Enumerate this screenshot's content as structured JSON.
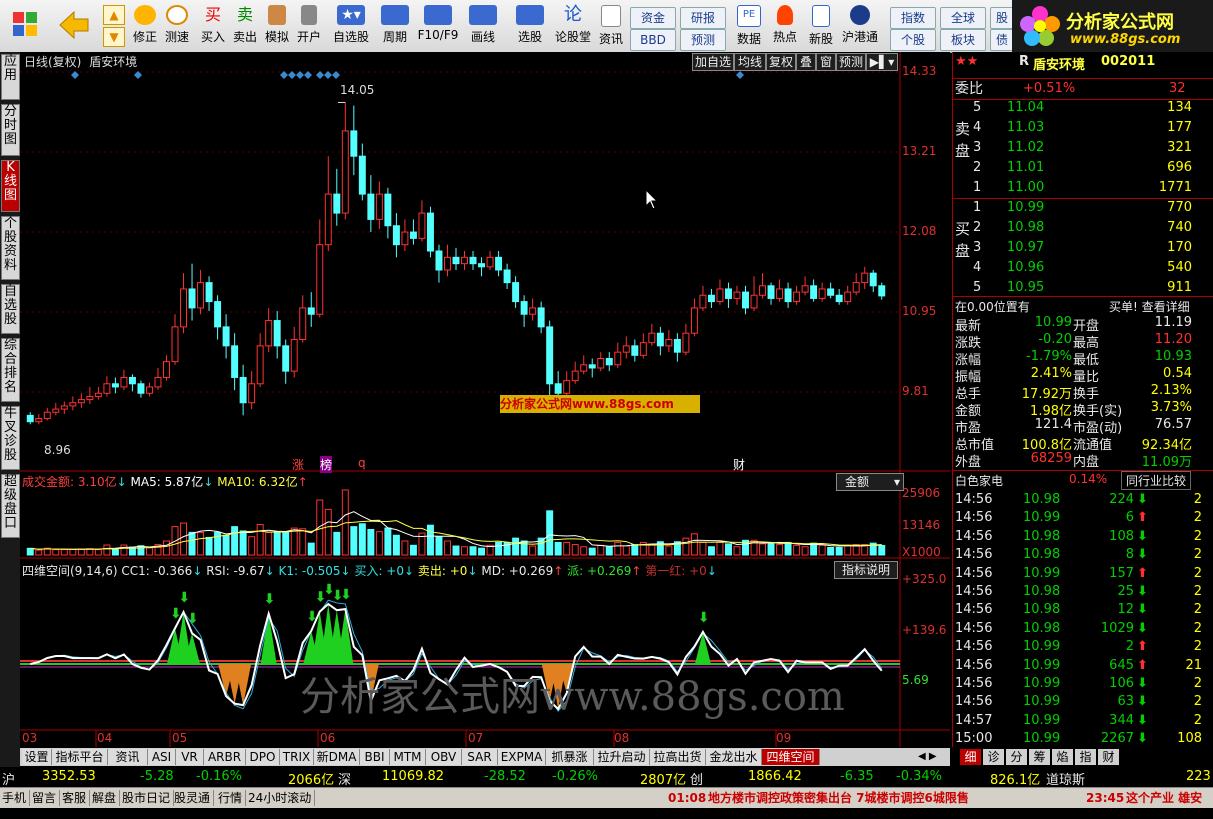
{
  "toolbar": {
    "buttons": [
      {
        "label": "修正"
      },
      {
        "label": "测速"
      },
      {
        "label": "买入"
      },
      {
        "label": "卖出"
      },
      {
        "label": "模拟"
      },
      {
        "label": "开户"
      },
      {
        "label": "自选股"
      },
      {
        "label": "周期"
      },
      {
        "label": "F10/F9"
      },
      {
        "label": "画线"
      },
      {
        "label": "选股"
      },
      {
        "label": "论股堂"
      },
      {
        "label": "资讯"
      },
      {
        "label": "数据"
      },
      {
        "label": "热点"
      },
      {
        "label": "新股"
      },
      {
        "label": "沪港通"
      }
    ],
    "small_buttons": [
      "资金",
      "研报",
      "BBD",
      "预测",
      "指数",
      "全球",
      "股",
      "个股",
      "板块",
      "债"
    ],
    "logo_text": "分析家公式网",
    "logo_url": "www.88gs.com"
  },
  "left_tabs": [
    "应用",
    "分时图",
    "K线图",
    "个股资料",
    "自选股",
    "综合排名",
    "牛叉诊股",
    "超级盘口"
  ],
  "chart": {
    "title": "日线(复权)",
    "stock_name": "盾安环境",
    "buttons": [
      "加自选",
      "均线",
      "复权",
      "叠",
      "窗",
      "预测"
    ],
    "price_labels": [
      "14.33",
      "13.21",
      "12.08",
      "10.95",
      "9.81"
    ],
    "high_label": "14.05",
    "low_label": "8.96",
    "event_labels": [
      "涨",
      "榜",
      "q",
      "财"
    ],
    "watermark_small": "分析家公式网www.88gs.com",
    "volume_header": {
      "label": "成交金额:",
      "value": "3.10亿",
      "ma5_label": "MA5:",
      "ma5": "5.87亿",
      "ma10_label": "MA10:",
      "ma10": "6.32亿"
    },
    "volume_select": "金额",
    "volume_labels": [
      "25906",
      "13146",
      "X1000"
    ],
    "indicator_header": {
      "name": "四维空间(9,14,6)",
      "cc1": "CC1: -0.366",
      "rsi": "RSI: -9.67",
      "k1": "K1: -0.505",
      "buy": "买入: +0",
      "sell": "卖出: +0",
      "md": "MD: +0.269",
      "pai": "派: +0.269",
      "red": "第一红: +0"
    },
    "indicator_button": "指标说明",
    "indicator_labels": [
      "+325.0",
      "+139.6",
      "5.69"
    ],
    "watermark_big": "分析家公式网www.88gs.com",
    "x_labels": [
      "03",
      "04",
      "05",
      "06",
      "07",
      "08",
      "09"
    ]
  },
  "chart_data": {
    "type": "candlestick",
    "title": "日线(复权) 盾安环境",
    "ylim": [
      8.6,
      14.5
    ],
    "x_axis_months": [
      "03",
      "04",
      "05",
      "06",
      "07",
      "08",
      "09"
    ],
    "candles": [
      [
        9.1,
        9.0,
        9.15,
        8.96
      ],
      [
        9.0,
        9.05,
        9.12,
        8.96
      ],
      [
        9.05,
        9.15,
        9.22,
        9.02
      ],
      [
        9.15,
        9.2,
        9.3,
        9.1
      ],
      [
        9.2,
        9.25,
        9.32,
        9.12
      ],
      [
        9.25,
        9.3,
        9.4,
        9.18
      ],
      [
        9.3,
        9.35,
        9.45,
        9.22
      ],
      [
        9.35,
        9.4,
        9.55,
        9.28
      ],
      [
        9.4,
        9.45,
        9.55,
        9.35
      ],
      [
        9.45,
        9.6,
        9.72,
        9.4
      ],
      [
        9.6,
        9.55,
        9.7,
        9.45
      ],
      [
        9.55,
        9.7,
        9.82,
        9.5
      ],
      [
        9.7,
        9.6,
        9.75,
        9.48
      ],
      [
        9.6,
        9.45,
        9.65,
        9.38
      ],
      [
        9.45,
        9.55,
        9.62,
        9.4
      ],
      [
        9.55,
        9.7,
        9.85,
        9.5
      ],
      [
        9.7,
        9.95,
        10.05,
        9.65
      ],
      [
        9.95,
        10.5,
        10.7,
        9.9
      ],
      [
        10.5,
        11.1,
        11.35,
        10.4
      ],
      [
        11.1,
        10.8,
        11.5,
        10.6
      ],
      [
        10.8,
        11.2,
        11.4,
        10.7
      ],
      [
        11.2,
        10.9,
        11.3,
        10.75
      ],
      [
        10.9,
        10.5,
        11.0,
        10.3
      ],
      [
        10.5,
        10.2,
        10.7,
        10.0
      ],
      [
        10.2,
        9.7,
        10.4,
        9.5
      ],
      [
        9.7,
        9.3,
        9.9,
        9.1
      ],
      [
        9.3,
        9.6,
        9.8,
        9.2
      ],
      [
        9.6,
        10.2,
        10.4,
        9.55
      ],
      [
        10.2,
        10.6,
        10.8,
        10.1
      ],
      [
        10.6,
        10.2,
        10.75,
        10.0
      ],
      [
        10.2,
        9.8,
        10.3,
        9.6
      ],
      [
        9.8,
        10.3,
        10.5,
        9.7
      ],
      [
        10.3,
        10.8,
        11.0,
        10.25
      ],
      [
        10.8,
        10.7,
        11.05,
        10.5
      ],
      [
        10.7,
        11.8,
        12.2,
        10.65
      ],
      [
        11.8,
        12.6,
        13.2,
        11.7
      ],
      [
        12.6,
        12.3,
        13.0,
        12.1
      ],
      [
        12.3,
        13.6,
        14.05,
        12.2
      ],
      [
        13.6,
        13.2,
        14.0,
        12.9
      ],
      [
        13.2,
        12.6,
        13.4,
        12.5
      ],
      [
        12.6,
        12.2,
        12.9,
        12.0
      ],
      [
        12.2,
        12.6,
        12.8,
        12.05
      ],
      [
        12.6,
        12.1,
        12.7,
        11.9
      ],
      [
        12.1,
        11.8,
        12.3,
        11.6
      ],
      [
        11.8,
        12.0,
        12.2,
        11.7
      ],
      [
        12.0,
        11.9,
        12.2,
        11.8
      ],
      [
        11.9,
        12.3,
        12.5,
        11.85
      ],
      [
        12.3,
        11.7,
        12.4,
        11.6
      ],
      [
        11.7,
        11.4,
        11.8,
        11.2
      ],
      [
        11.4,
        11.6,
        11.8,
        11.3
      ],
      [
        11.6,
        11.5,
        11.75,
        11.4
      ],
      [
        11.5,
        11.6,
        11.7,
        11.4
      ],
      [
        11.6,
        11.5,
        11.7,
        11.4
      ],
      [
        11.5,
        11.45,
        11.6,
        11.3
      ],
      [
        11.45,
        11.6,
        11.7,
        11.4
      ],
      [
        11.6,
        11.4,
        11.7,
        11.3
      ],
      [
        11.4,
        11.2,
        11.5,
        11.1
      ],
      [
        11.2,
        10.9,
        11.3,
        10.8
      ],
      [
        10.9,
        10.7,
        11.0,
        10.5
      ],
      [
        10.7,
        10.8,
        10.95,
        10.6
      ],
      [
        10.8,
        10.5,
        10.9,
        10.4
      ],
      [
        10.5,
        9.6,
        10.6,
        9.4
      ],
      [
        9.6,
        9.45,
        9.8,
        9.3
      ],
      [
        9.45,
        9.65,
        9.8,
        9.4
      ],
      [
        9.65,
        9.8,
        9.95,
        9.6
      ],
      [
        9.8,
        9.9,
        10.05,
        9.75
      ],
      [
        9.9,
        9.85,
        10.0,
        9.7
      ],
      [
        9.85,
        10.0,
        10.1,
        9.8
      ],
      [
        10.0,
        9.9,
        10.1,
        9.8
      ],
      [
        9.9,
        10.1,
        10.25,
        9.85
      ],
      [
        10.1,
        10.2,
        10.35,
        10.0
      ],
      [
        10.2,
        10.05,
        10.3,
        9.95
      ],
      [
        10.05,
        10.25,
        10.4,
        10.0
      ],
      [
        10.25,
        10.4,
        10.55,
        10.2
      ],
      [
        10.4,
        10.2,
        10.5,
        10.05
      ],
      [
        10.2,
        10.3,
        10.45,
        10.1
      ],
      [
        10.3,
        10.1,
        10.4,
        9.95
      ],
      [
        10.1,
        10.4,
        10.55,
        10.05
      ],
      [
        10.4,
        10.8,
        10.95,
        10.35
      ],
      [
        10.8,
        11.0,
        11.15,
        10.75
      ],
      [
        11.0,
        10.9,
        11.1,
        10.8
      ],
      [
        10.9,
        11.1,
        11.25,
        10.85
      ],
      [
        11.1,
        10.95,
        11.2,
        10.8
      ],
      [
        10.95,
        11.05,
        11.15,
        10.85
      ],
      [
        11.05,
        10.8,
        11.15,
        10.7
      ],
      [
        10.8,
        11.0,
        11.3,
        10.75
      ],
      [
        11.0,
        11.15,
        11.35,
        10.95
      ],
      [
        11.15,
        10.95,
        11.2,
        10.85
      ],
      [
        10.95,
        11.1,
        11.25,
        10.9
      ],
      [
        11.1,
        10.9,
        11.2,
        10.8
      ],
      [
        10.9,
        11.05,
        11.15,
        10.85
      ],
      [
        11.05,
        11.15,
        11.3,
        11.0
      ],
      [
        11.15,
        10.95,
        11.25,
        10.9
      ],
      [
        10.95,
        11.1,
        11.2,
        10.9
      ],
      [
        11.1,
        11.0,
        11.2,
        10.95
      ],
      [
        11.0,
        10.9,
        11.1,
        10.85
      ],
      [
        10.9,
        11.05,
        11.15,
        10.85
      ],
      [
        11.05,
        11.2,
        11.35,
        11.0
      ],
      [
        11.2,
        11.35,
        11.45,
        11.1
      ],
      [
        11.35,
        11.15,
        11.4,
        11.05
      ],
      [
        11.15,
        10.99,
        11.2,
        10.93
      ]
    ],
    "volume_ylim": [
      0,
      25906
    ],
    "volume_ma": [
      "MA5",
      "MA10"
    ]
  },
  "quote": {
    "stock_name": "盾安环境",
    "stock_code": "002011",
    "weibi_label": "委比",
    "weibi": "+0.51%",
    "weibi_diff": "32",
    "sell_label": "卖盘",
    "buy_label": "买盘",
    "sells": [
      {
        "level": "5",
        "price": "11.04",
        "vol": "134"
      },
      {
        "level": "4",
        "price": "11.03",
        "vol": "177"
      },
      {
        "level": "3",
        "price": "11.02",
        "vol": "321"
      },
      {
        "level": "2",
        "price": "11.01",
        "vol": "696"
      },
      {
        "level": "1",
        "price": "11.00",
        "vol": "1771"
      }
    ],
    "buys": [
      {
        "level": "1",
        "price": "10.99",
        "vol": "770"
      },
      {
        "level": "2",
        "price": "10.98",
        "vol": "740"
      },
      {
        "level": "3",
        "price": "10.97",
        "vol": "170"
      },
      {
        "level": "4",
        "price": "10.96",
        "vol": "540"
      },
      {
        "level": "5",
        "price": "10.95",
        "vol": "911"
      }
    ],
    "position_label": "在0.00位置有",
    "detail_label": "买单! 查看详细",
    "stats": [
      {
        "l1": "最新",
        "v1": "10.99",
        "l2": "开盘",
        "v2": "11.19"
      },
      {
        "l1": "涨跌",
        "v1": "-0.20",
        "l2": "最高",
        "v2": "11.20"
      },
      {
        "l1": "涨幅",
        "v1": "-1.79%",
        "l2": "最低",
        "v2": "10.93"
      },
      {
        "l1": "振幅",
        "v1": "2.41%",
        "l2": "量比",
        "v2": "0.54"
      },
      {
        "l1": "总手",
        "v1": "17.92万",
        "l2": "换手",
        "v2": "2.13%"
      },
      {
        "l1": "金额",
        "v1": "1.98亿",
        "l2": "换手(实)",
        "v2": "3.73%"
      },
      {
        "l1": "市盈",
        "v1": "121.4",
        "l2": "市盈(动)",
        "v2": "76.57"
      },
      {
        "l1": "总市值",
        "v1": "100.8亿",
        "l2": "流通值",
        "v2": "92.34亿"
      },
      {
        "l1": "外盘",
        "v1": "68259",
        "l2": "内盘",
        "v2": "11.09万"
      }
    ],
    "industry": "白色家电",
    "industry_change": "0.14%",
    "compare_label": "同行业比较",
    "trades": [
      {
        "t": "14:56",
        "p": "10.98",
        "v": "224",
        "d": "down",
        "n": "2"
      },
      {
        "t": "14:56",
        "p": "10.99",
        "v": "6",
        "d": "up",
        "n": "2"
      },
      {
        "t": "14:56",
        "p": "10.98",
        "v": "108",
        "d": "down",
        "n": "2"
      },
      {
        "t": "14:56",
        "p": "10.98",
        "v": "8",
        "d": "down",
        "n": "2"
      },
      {
        "t": "14:56",
        "p": "10.99",
        "v": "157",
        "d": "up",
        "n": "2"
      },
      {
        "t": "14:56",
        "p": "10.98",
        "v": "25",
        "d": "down",
        "n": "2"
      },
      {
        "t": "14:56",
        "p": "10.98",
        "v": "12",
        "d": "down",
        "n": "2"
      },
      {
        "t": "14:56",
        "p": "10.98",
        "v": "1029",
        "d": "down",
        "n": "2"
      },
      {
        "t": "14:56",
        "p": "10.99",
        "v": "2",
        "d": "up",
        "n": "2"
      },
      {
        "t": "14:56",
        "p": "10.99",
        "v": "645",
        "d": "up",
        "n": "21"
      },
      {
        "t": "14:56",
        "p": "10.99",
        "v": "106",
        "d": "down",
        "n": "2"
      },
      {
        "t": "14:56",
        "p": "10.99",
        "v": "63",
        "d": "down",
        "n": "2"
      },
      {
        "t": "14:57",
        "p": "10.99",
        "v": "344",
        "d": "down",
        "n": "2"
      },
      {
        "t": "15:00",
        "p": "10.99",
        "v": "2267",
        "d": "down",
        "n": "108"
      }
    ],
    "bottom_tabs": [
      "细",
      "诊",
      "分",
      "筹",
      "焰",
      "指",
      "财"
    ]
  },
  "bottom_tabs": [
    "设置",
    "指标平台",
    "资讯",
    "ASI",
    "VR",
    "ARBR",
    "DPO",
    "TRIX",
    "新DMA",
    "BBI",
    "MTM",
    "OBV",
    "SAR",
    "EXPMA",
    "抓暴涨",
    "拉升启动",
    "拉高出货",
    "金龙出水",
    "四维空间"
  ],
  "ticker": {
    "sh_label": "沪",
    "sh_index": "3352.53",
    "sh_chg": "-5.28",
    "sh_pct": "-0.16%",
    "sh_amt": "2066亿",
    "sz_label": "深",
    "sz_index": "11069.82",
    "sz_chg": "-28.52",
    "sz_pct": "-0.26%",
    "sz_amt": "2807亿",
    "cy_label": "创",
    "cy_index": "1866.42",
    "cy_chg": "-6.35",
    "cy_pct": "-0.34%",
    "cy_amt": "826.1亿",
    "dj_label": "道琼斯",
    "dj_index": "223"
  },
  "status": {
    "items": [
      "手机",
      "留言",
      "客服",
      "解盘",
      "股市日记",
      "股灵通",
      "行情",
      "24小时滚动"
    ],
    "news1_time": "01:08",
    "news1": "地方楼市调控政策密集出台 7城楼市调控6城限售",
    "news2_time": "23:45",
    "news2": "这个产业 雄安"
  }
}
